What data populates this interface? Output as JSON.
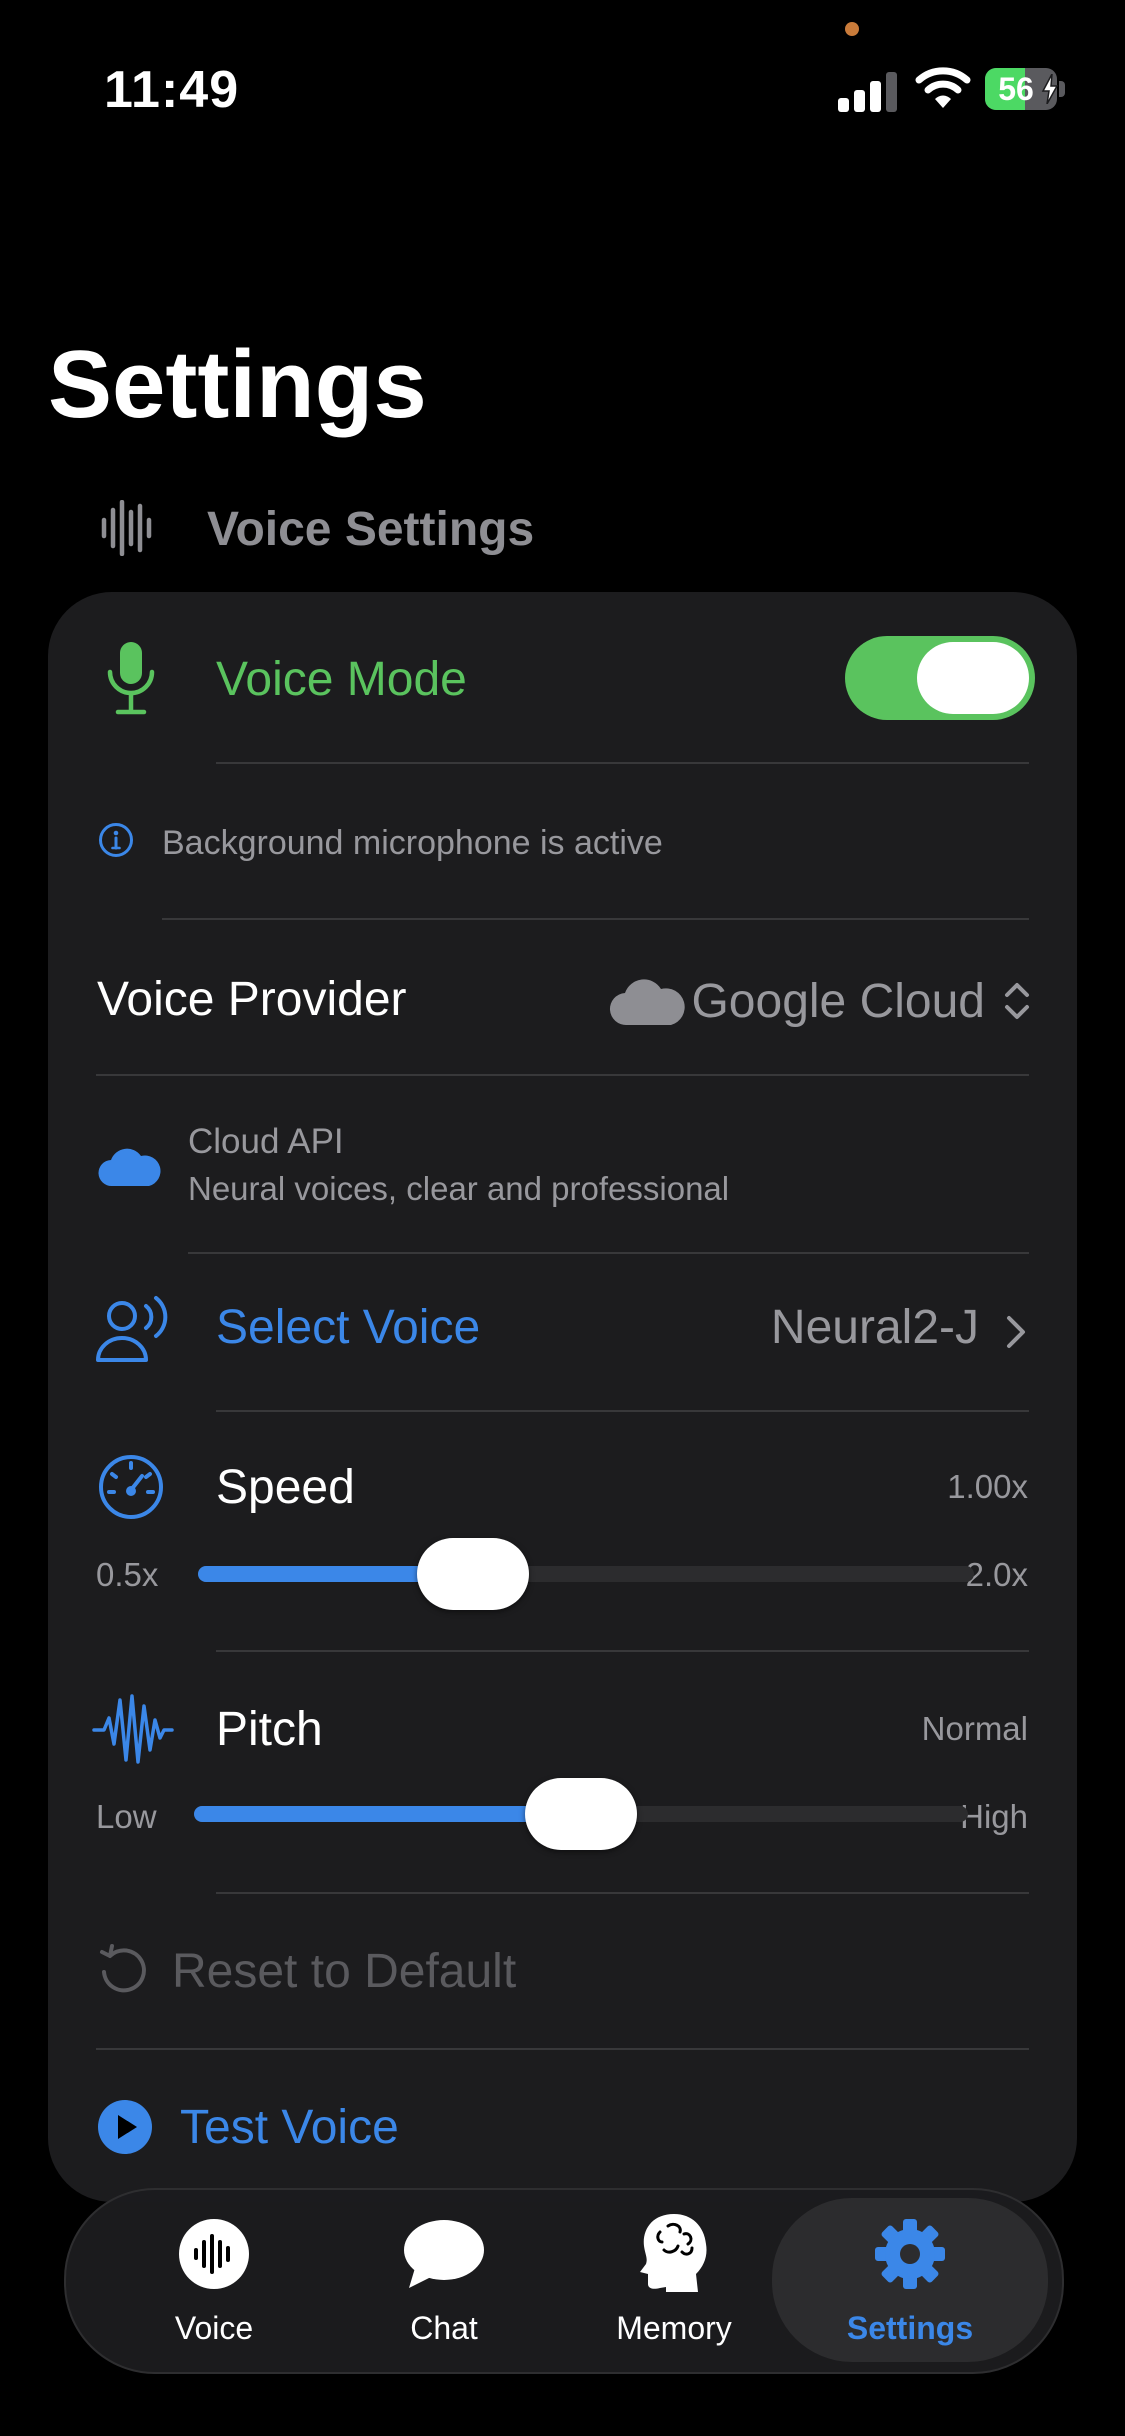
{
  "status_bar": {
    "time": "11:49",
    "battery_percent": "56",
    "signal_bars": 3,
    "battery_level": 0.56
  },
  "page": {
    "title": "Settings"
  },
  "section": {
    "title": "Voice Settings",
    "icon": "waveform-icon"
  },
  "voice_mode": {
    "label": "Voice Mode",
    "enabled": true,
    "icon": "microphone-icon"
  },
  "mic_notice": {
    "text": "Background microphone is active",
    "icon": "info-icon"
  },
  "voice_provider": {
    "label": "Voice Provider",
    "value": "Google Cloud",
    "icon": "cloud-icon"
  },
  "provider_info": {
    "title": "Cloud API",
    "subtitle": "Neural voices, clear and professional"
  },
  "select_voice": {
    "label": "Select Voice",
    "value": "Neural2-J"
  },
  "speed": {
    "label": "Speed",
    "value": "1.00x",
    "min_label": "0.5x",
    "max_label": "2.0x",
    "fraction": 0.33
  },
  "pitch": {
    "label": "Pitch",
    "value": "Normal",
    "min_label": "Low",
    "max_label": "High",
    "fraction": 0.5
  },
  "reset": {
    "label": "Reset to Default"
  },
  "test_voice": {
    "label": "Test Voice"
  },
  "tabs": [
    {
      "label": "Voice",
      "icon": "voice-tab-icon",
      "active": false
    },
    {
      "label": "Chat",
      "icon": "chat-bubble-icon",
      "active": false
    },
    {
      "label": "Memory",
      "icon": "brain-head-icon",
      "active": false
    },
    {
      "label": "Settings",
      "icon": "gear-icon",
      "active": true
    }
  ],
  "colors": {
    "accent_blue": "#3b87e8",
    "accent_green": "#5ac35e",
    "card_bg": "#1c1c1e",
    "secondary_text": "#98989d"
  }
}
